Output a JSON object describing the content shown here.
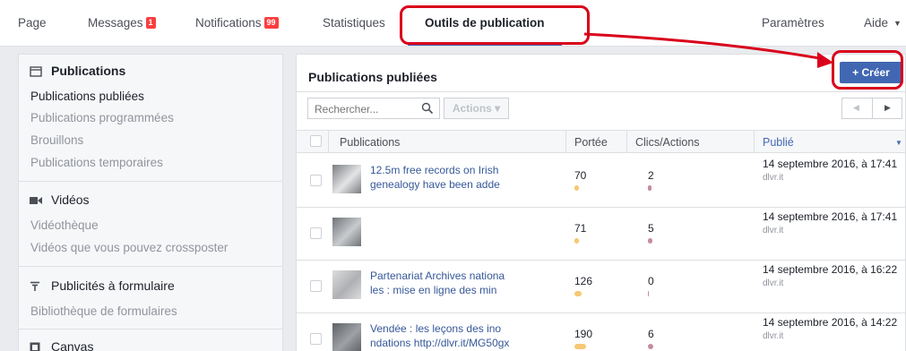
{
  "nav": {
    "tabs": [
      {
        "label": "Page"
      },
      {
        "label": "Messages",
        "badge": "1"
      },
      {
        "label": "Notifications",
        "badge": "99"
      },
      {
        "label": "Statistiques"
      },
      {
        "label": "Outils de publication",
        "active": true
      }
    ],
    "right": [
      {
        "label": "Paramètres"
      },
      {
        "label": "Aide"
      }
    ],
    "accent": "#4267b2",
    "badge_color": "#fa3e3e"
  },
  "sidebar": {
    "sections": [
      {
        "icon": "calendar-icon",
        "title": "Publications",
        "items": [
          {
            "label": "Publications publiées",
            "current": true
          },
          {
            "label": "Publications programmées"
          },
          {
            "label": "Brouillons"
          },
          {
            "label": "Publications temporaires"
          }
        ]
      },
      {
        "icon": "video-camera-icon",
        "title": "Vidéos",
        "items": [
          {
            "label": "Vidéothèque"
          },
          {
            "label": "Vidéos que vous pouvez crossposter"
          }
        ]
      },
      {
        "icon": "filter-icon",
        "title": "Publicités à formulaire",
        "items": [
          {
            "label": "Bibliothèque de formulaires"
          }
        ]
      },
      {
        "icon": "canvas-icon",
        "title": "Canvas",
        "items": []
      }
    ]
  },
  "main": {
    "title": "Publications publiées",
    "create_label": "+ Créer",
    "search_placeholder": "Rechercher...",
    "actions_label": "Actions ▾",
    "columns": [
      "Publications",
      "Portée",
      "Clics/Actions",
      "Publié"
    ],
    "rows": [
      {
        "text": "12.5m free records on Irish genealogy have been adde",
        "reach": "70",
        "reach_pct": 0.08,
        "clicks": "2",
        "clicks_pct": 0.03,
        "date": "14 septembre 2016, à 17:41",
        "source": "dlvr.it"
      },
      {
        "text": "",
        "reach": "71",
        "reach_pct": 0.08,
        "clicks": "5",
        "clicks_pct": 0.09,
        "date": "14 septembre 2016, à 17:41",
        "source": "dlvr.it"
      },
      {
        "text": "Partenariat Archives nationa les : mise en ligne des min",
        "reach": "126",
        "reach_pct": 0.14,
        "clicks": "0",
        "clicks_pct": 0.0,
        "date": "14 septembre 2016, à 16:22",
        "source": "dlvr.it"
      },
      {
        "text": "Vendée : les leçons des ino ndations http://dlvr.it/MG50gx",
        "reach": "190",
        "reach_pct": 0.21,
        "clicks": "6",
        "clicks_pct": 0.1,
        "date": "14 septembre 2016, à 14:22",
        "source": "dlvr.it"
      }
    ],
    "reach_color": "#f7c873",
    "clicks_color": "#c48ca3"
  },
  "annotation_color": "#d9001b"
}
